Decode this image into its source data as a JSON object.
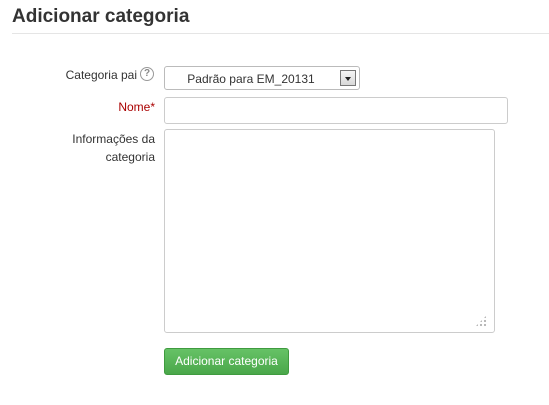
{
  "page": {
    "title": "Adicionar categoria"
  },
  "form": {
    "parent_category": {
      "label": "Categoria pai",
      "help_icon": "question-circle-icon",
      "selected_value": "Padrão para EM_20131"
    },
    "name": {
      "label": "Nome",
      "required_marker": "*",
      "value": ""
    },
    "description": {
      "label_line1": "Informações da",
      "label_line2": "categoria",
      "value": ""
    },
    "submit_label": "Adicionar categoria"
  },
  "colors": {
    "required_label": "#aa0000",
    "button_green": "#5cb85c",
    "text": "#333333"
  }
}
